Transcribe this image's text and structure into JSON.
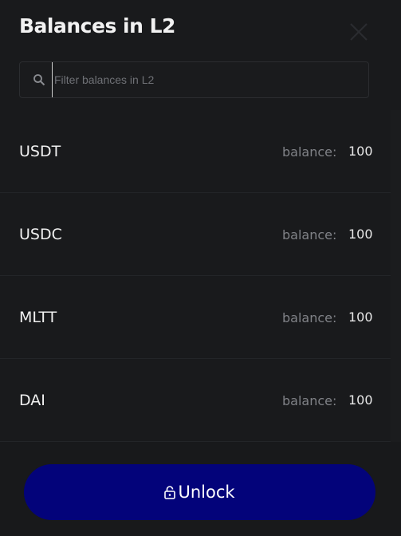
{
  "dialog": {
    "title": "Balances in L2",
    "close_icon": "close-icon"
  },
  "search": {
    "placeholder": "Filter balances in L2",
    "value": "",
    "icon": "search-icon"
  },
  "balances": [
    {
      "token": "USDT",
      "label": "balance:",
      "value": "100"
    },
    {
      "token": "USDC",
      "label": "balance:",
      "value": "100"
    },
    {
      "token": "MLTT",
      "label": "balance:",
      "value": "100"
    },
    {
      "token": "DAI",
      "label": "balance:",
      "value": "100"
    }
  ],
  "footer": {
    "unlock_label": "Unlock",
    "unlock_icon": "unlock-icon"
  },
  "colors": {
    "background": "#191a1c",
    "button": "#03037a",
    "muted_text": "#808287"
  }
}
